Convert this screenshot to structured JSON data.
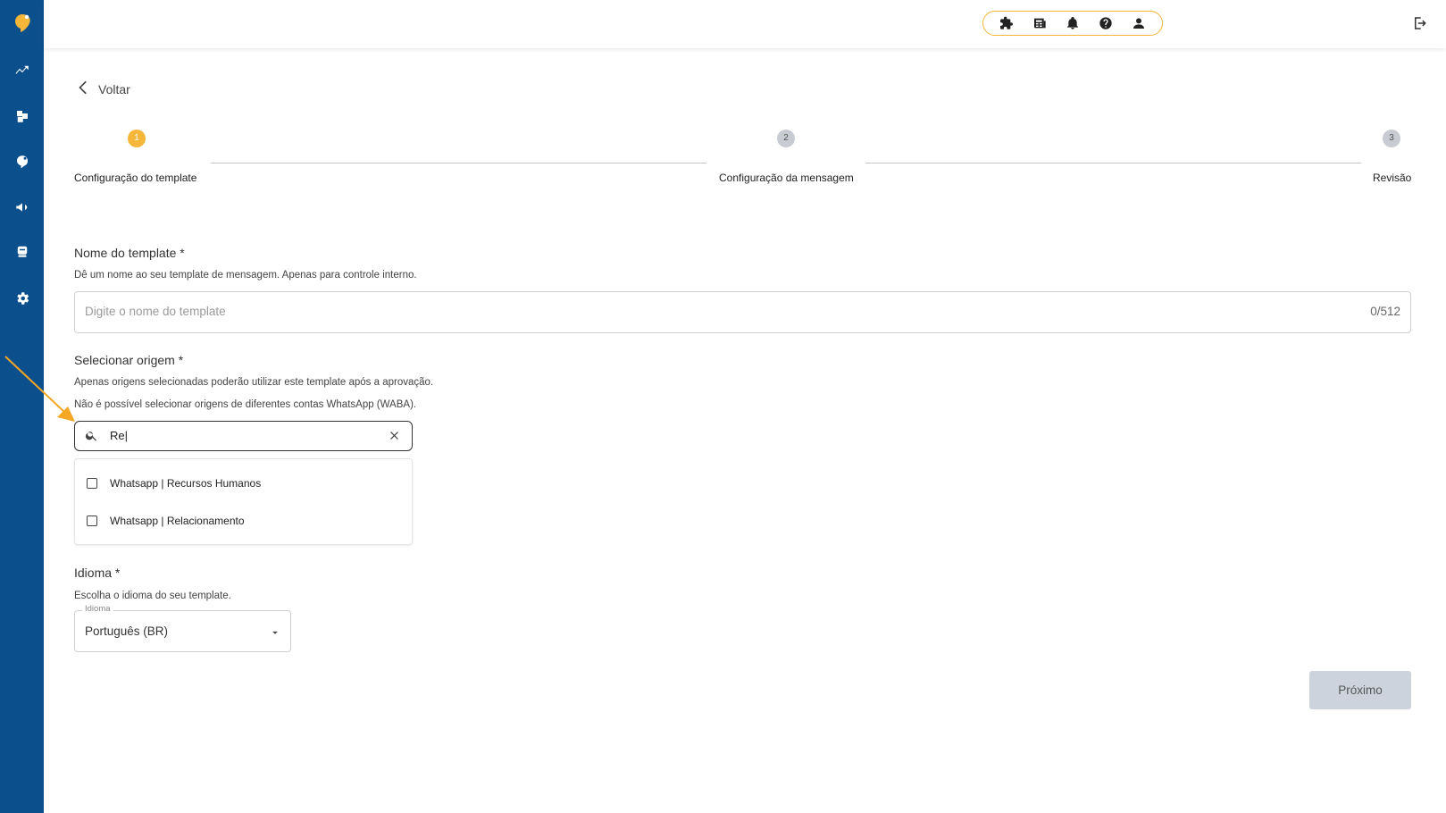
{
  "topbar": {
    "icons": [
      "puzzle-icon",
      "newspaper-icon",
      "bell-icon",
      "help-icon",
      "user-icon"
    ],
    "accent_color": "#f5b63a"
  },
  "sidebar": {
    "background": "#0b4f8c",
    "items": [
      "logo-icon",
      "analytics-icon",
      "boxes-icon",
      "contacts-icon",
      "campaign-icon",
      "bot-icon",
      "gear-icon"
    ]
  },
  "back": {
    "label": "Voltar"
  },
  "stepper": {
    "steps": [
      {
        "number": "1",
        "label": "Configuração do template",
        "active": true
      },
      {
        "number": "2",
        "label": "Configuração da mensagem",
        "active": false
      },
      {
        "number": "3",
        "label": "Revisão",
        "active": false
      }
    ],
    "active_color": "#f5b63a",
    "inactive_color": "#c8ccd2"
  },
  "template_name": {
    "label": "Nome do template *",
    "description": "Dê um nome ao seu template de mensagem. Apenas para controle interno.",
    "placeholder": "Digite o nome do template",
    "value": "",
    "counter": "0/512"
  },
  "origin": {
    "label": "Selecionar origem *",
    "description_1": "Apenas origens selecionadas poderão utilizar este template após a aprovação.",
    "description_2": "Não é possível selecionar origens de diferentes contas WhatsApp (WABA).",
    "search_value": "Re|",
    "options": [
      {
        "label": "Whatsapp | Recursos Humanos",
        "checked": false
      },
      {
        "label": "Whatsapp | Relacionamento",
        "checked": false
      }
    ]
  },
  "language": {
    "label": "Idioma *",
    "description": "Escolha o idioma do seu template.",
    "field_label": "Idioma",
    "value": "Português (BR)"
  },
  "next_button": {
    "label": "Próximo"
  },
  "annotation_color": "#f5a623"
}
